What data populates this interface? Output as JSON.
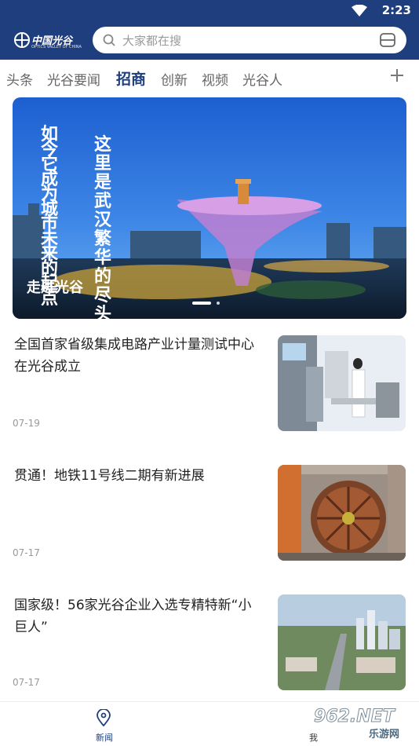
{
  "status_bar": {
    "time": "2:23"
  },
  "header": {
    "logo_text": "中国光谷",
    "logo_subtext": "OPTICS VALLEY OF CHINA",
    "search_placeholder": "大家都在搜"
  },
  "tabs": [
    {
      "label": "头条"
    },
    {
      "label": "光谷要闻"
    },
    {
      "label": "招商",
      "active": true
    },
    {
      "label": "创新"
    },
    {
      "label": "视频"
    },
    {
      "label": "光谷人"
    }
  ],
  "banner": {
    "poster_lines": [
      "这里是武汉繁华的尽头",
      "如今它成为城市未来的起点"
    ],
    "caption": "走进光谷",
    "slide_count": 2,
    "current_slide": 1
  },
  "news": [
    {
      "title": "全国首家省级集成电路产业计量测试中心在光谷成立",
      "date": "07-19"
    },
    {
      "title": "贯通！地铁11号线二期有新进展",
      "date": "07-17"
    },
    {
      "title": "国家级！56家光谷企业入选专精特新“小巨人”",
      "date": "07-17"
    }
  ],
  "bottom_nav": [
    {
      "label": "新闻",
      "icon": "location-pin-icon",
      "active": true
    },
    {
      "label": "我",
      "icon": "person-icon"
    }
  ],
  "watermark": {
    "brand": "962.NET",
    "sub": "乐游网"
  },
  "colors": {
    "brand": "#1f3e7e",
    "text": "#222222",
    "muted": "#999999"
  }
}
